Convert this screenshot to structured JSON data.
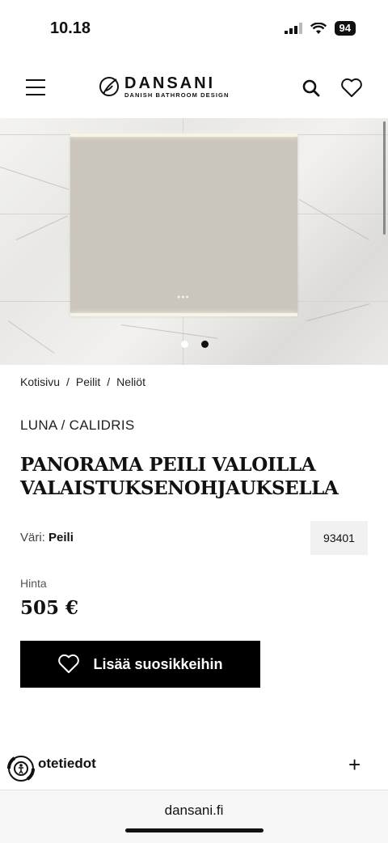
{
  "status_bar": {
    "time": "10.18",
    "battery": "94"
  },
  "header": {
    "logo_name": "DANSANI",
    "logo_tagline": "DANISH BATHROOM DESIGN"
  },
  "gallery": {
    "active_index": 2,
    "total": 2
  },
  "breadcrumb": [
    "Kotisivu",
    "Peilit",
    "Neliöt"
  ],
  "product": {
    "brand_line": "LUNA / CALIDRIS",
    "title_line1": "PANORAMA PEILI VALOILLA",
    "title_line2": "VALAISTUKSENOHJAUKSELLA",
    "color_label": "Väri:",
    "color_value": "Peili",
    "sku": "93401",
    "price_label": "Hinta",
    "price": "505 €",
    "favorite_button": "Lisää suosikkeihin"
  },
  "accordion": {
    "label": "otetiedot"
  },
  "browser": {
    "url": "dansani.fi"
  },
  "colors": {
    "button_bg": "#000000",
    "mirror": "#cbc6bd"
  }
}
